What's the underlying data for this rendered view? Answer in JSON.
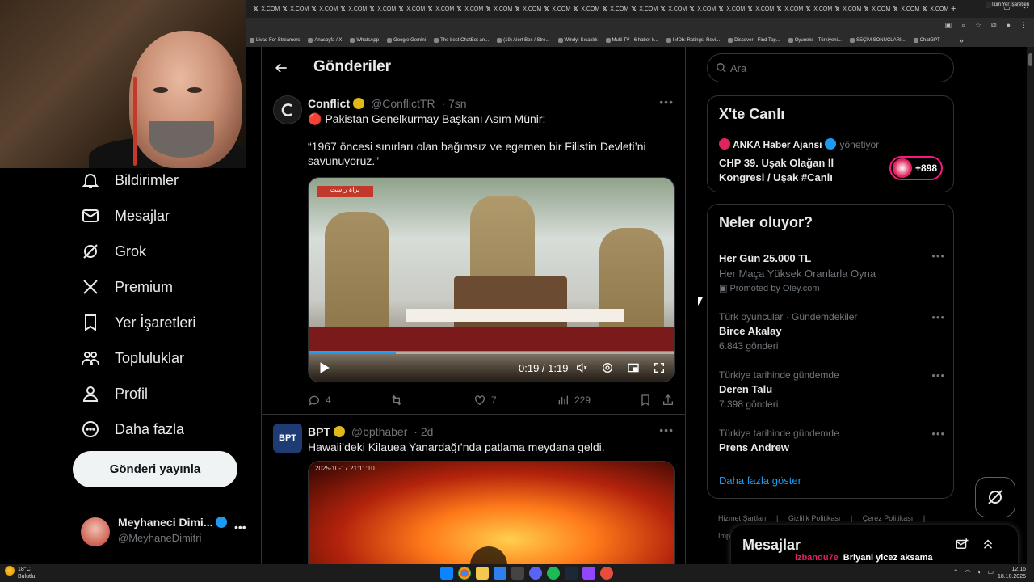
{
  "browser": {
    "tab_label": "X.COM",
    "tab_count": 24,
    "new_tab": "+",
    "window_controls": [
      "–",
      "▢",
      "✕"
    ],
    "bookmarks": [
      "Livad For Streamers",
      "Anasayfa / X",
      "WhatsApp",
      "Google Gemini",
      "The best ChatBot an...",
      "(19) Alert Box / Stre...",
      "Windy: Sıcaklık",
      "Multi TV - 6 haber k...",
      "IMDb: Ratings, Revi...",
      "Discover - Find Top...",
      "Oyuneks - Türkiyeni...",
      "SEÇİM SONUÇLARI...",
      "ChatGPT"
    ],
    "bookmarks_more": "»",
    "all_bookmarks": "Tüm Yer İşaretleri"
  },
  "nav": {
    "items": [
      {
        "label": "Bildirimler",
        "icon": "bell-icon"
      },
      {
        "label": "Mesajlar",
        "icon": "envelope-icon"
      },
      {
        "label": "Grok",
        "icon": "grok-icon"
      },
      {
        "label": "Premium",
        "icon": "x-logo-icon"
      },
      {
        "label": "Yer İşaretleri",
        "icon": "bookmark-icon"
      },
      {
        "label": "Topluluklar",
        "icon": "people-icon"
      },
      {
        "label": "Profil",
        "icon": "person-icon"
      },
      {
        "label": "Daha fazla",
        "icon": "more-circle-icon"
      }
    ],
    "post_button": "Gönderi yayınla",
    "profile": {
      "name": "Meyhaneci Dimi...",
      "handle": "@MeyhaneDimitri",
      "more": "•••"
    }
  },
  "main": {
    "title": "Gönderiler",
    "tweets": [
      {
        "name": "Conflict",
        "handle": "@ConflictTR",
        "time": "· 7sn",
        "more": "•••",
        "line1": "🔴 Pakistan Genelkurmay Başkanı Asım Münir:",
        "line2": "“1967 öncesi sınırları olan bağımsız ve egemen bir Filistin Devleti’ni savunuyoruz.”",
        "video": {
          "elapsed": "0:19",
          "duration": "1:19",
          "time_text": "0:19 / 1:19",
          "progress": 0.24,
          "tag": "براہ راست"
        },
        "replies": "4",
        "retweets": "",
        "likes": "7",
        "views": "229"
      },
      {
        "name": "BPT",
        "handle": "@bpthaber",
        "time": "· 2d",
        "more": "•••",
        "text": "Hawaii’deki Kilauea Yanardağı’nda patlama meydana geldi.",
        "video_timestamp": "2025-10-17 21:11:10"
      }
    ]
  },
  "right": {
    "search_placeholder": "Ara",
    "live": {
      "title": "X'te Canlı",
      "host": "ANKA Haber Ajansı",
      "role": "yönetiyor",
      "event": "CHP 39. Uşak Olağan İl Kongresi / Uşak #Canlı",
      "listeners": "+898"
    },
    "trends": {
      "title": "Neler oluyor?",
      "promo": {
        "name": "Her Gün 25.000 TL",
        "sub": "Her Maça Yüksek Oranlarla Oyna",
        "promoted": "Promoted by Oley.com"
      },
      "items": [
        {
          "meta": "Türk oyuncular · Gündemdekiler",
          "name": "Birce Akalay",
          "count": "6.843 gönderi"
        },
        {
          "meta": "Türkiye tarihinde gündemde",
          "name": "Deren Talu",
          "count": "7.398 gönderi"
        },
        {
          "meta": "Türkiye tarihinde gündemde",
          "name": "Prens Andrew",
          "count": ""
        }
      ],
      "more_dots": "•••",
      "show_more": "Daha fazla göster"
    },
    "footer": [
      "Hizmet Şartları",
      "|",
      "Gizlilik Politikası",
      "|",
      "Çerez Politikası",
      "|"
    ],
    "footer2": "Imp"
  },
  "messages": {
    "title": "Mesajlar"
  },
  "chat": [
    {
      "user": "izbandu7e",
      "msg": "Briyani yicez aksama"
    },
    {
      "user": "izbandu7e",
      "msg": ""
    }
  ],
  "taskbar": {
    "temp": "18°C",
    "condition": "Bulutlu",
    "time": "12:16",
    "date": "18.10.2025"
  },
  "colors": {
    "accent": "#1d9bf0",
    "verified_gold": "#e2b719",
    "verified_blue": "#1d9bf0",
    "live_pink": "#f91880"
  }
}
